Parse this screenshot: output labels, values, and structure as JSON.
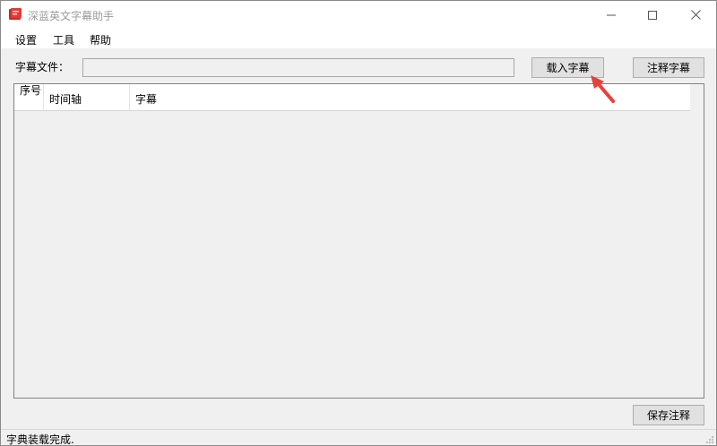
{
  "window": {
    "title": "深蓝英文字幕助手",
    "icon": "app-book-icon",
    "controls": [
      "minimize-icon",
      "maximize-icon",
      "close-icon"
    ]
  },
  "menu": {
    "items": [
      "设置",
      "工具",
      "帮助"
    ]
  },
  "file_row": {
    "label": "字幕文件：",
    "value": "",
    "load_button": "载入字幕",
    "annotate_button": "注释字幕"
  },
  "table": {
    "columns": [
      "序号",
      "时间轴",
      "字幕"
    ],
    "rows": []
  },
  "footer": {
    "save_button": "保存注释"
  },
  "status": {
    "text": "字典装载完成."
  },
  "colors": {
    "arrow": "#e8413c",
    "icon_red": "#c62828"
  }
}
